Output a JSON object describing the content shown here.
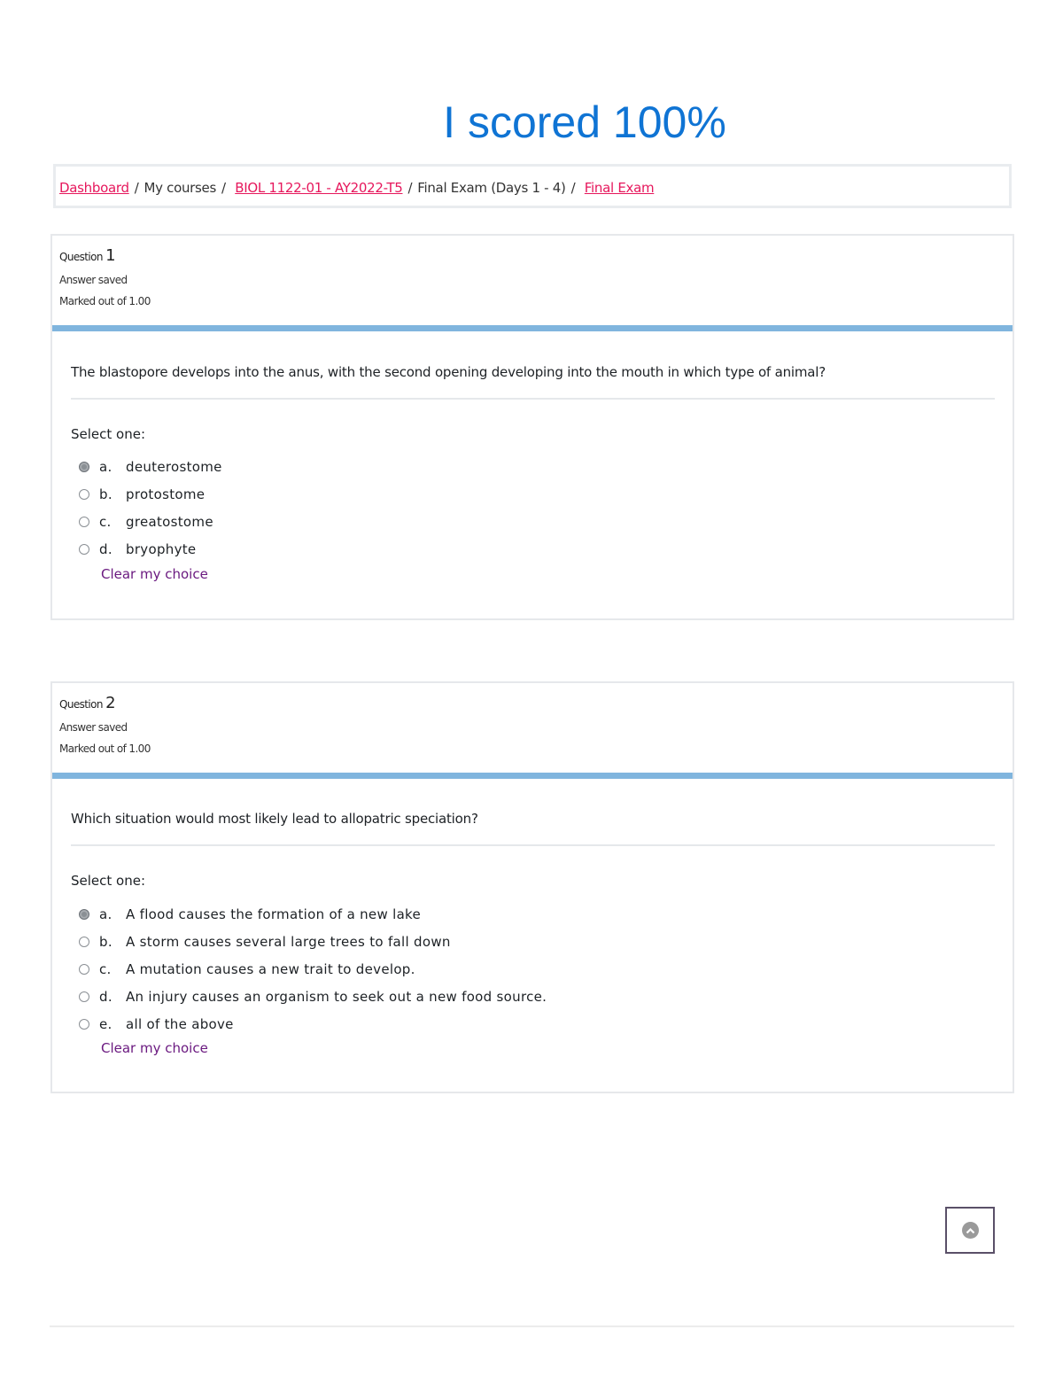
{
  "headline": "I scored 100%",
  "breadcrumb": {
    "items": [
      {
        "label": "Dashboard",
        "link": true
      },
      {
        "label": "My courses",
        "link": false
      },
      {
        "label": "BIOL 1122-01 - AY2022-T5",
        "link": true
      },
      {
        "label": "Final Exam (Days 1 - 4)",
        "link": false
      },
      {
        "label": "Final Exam",
        "link": true
      }
    ],
    "separator": "/"
  },
  "questions": [
    {
      "label": "Question",
      "number": "1",
      "status": "Answer saved",
      "marks": "Marked out of 1.00",
      "text": "The blastopore develops into the anus, with the second opening developing into the mouth in which type of animal?",
      "prompt": "Select one:",
      "options": [
        {
          "letter": "a.",
          "text": "deuterostome",
          "selected": true
        },
        {
          "letter": "b.",
          "text": "protostome",
          "selected": false
        },
        {
          "letter": "c.",
          "text": "greatostome",
          "selected": false
        },
        {
          "letter": "d.",
          "text": "bryophyte",
          "selected": false
        }
      ],
      "clear_label": "Clear my choice"
    },
    {
      "label": "Question",
      "number": "2",
      "status": "Answer saved",
      "marks": "Marked out of 1.00",
      "text": "Which situation would most likely lead to allopatric speciation?",
      "prompt": "Select one:",
      "options": [
        {
          "letter": "a.",
          "text": "A flood causes the formation of a new lake",
          "selected": true
        },
        {
          "letter": "b.",
          "text": "A storm causes several large trees to fall down",
          "selected": false
        },
        {
          "letter": "c.",
          "text": "A mutation causes a new trait to develop.",
          "selected": false
        },
        {
          "letter": "d.",
          "text": "An injury causes an organism to seek out a new food source.",
          "selected": false
        },
        {
          "letter": "e.",
          "text": "all of the above",
          "selected": false
        }
      ],
      "clear_label": "Clear my choice"
    }
  ],
  "scroll_top": {
    "icon": "chevron-up-circle-icon"
  },
  "colors": {
    "headline": "#0f74d4",
    "link": "#e6175c",
    "clear_link": "#6b1a80",
    "question_bar": "#80b5de"
  }
}
